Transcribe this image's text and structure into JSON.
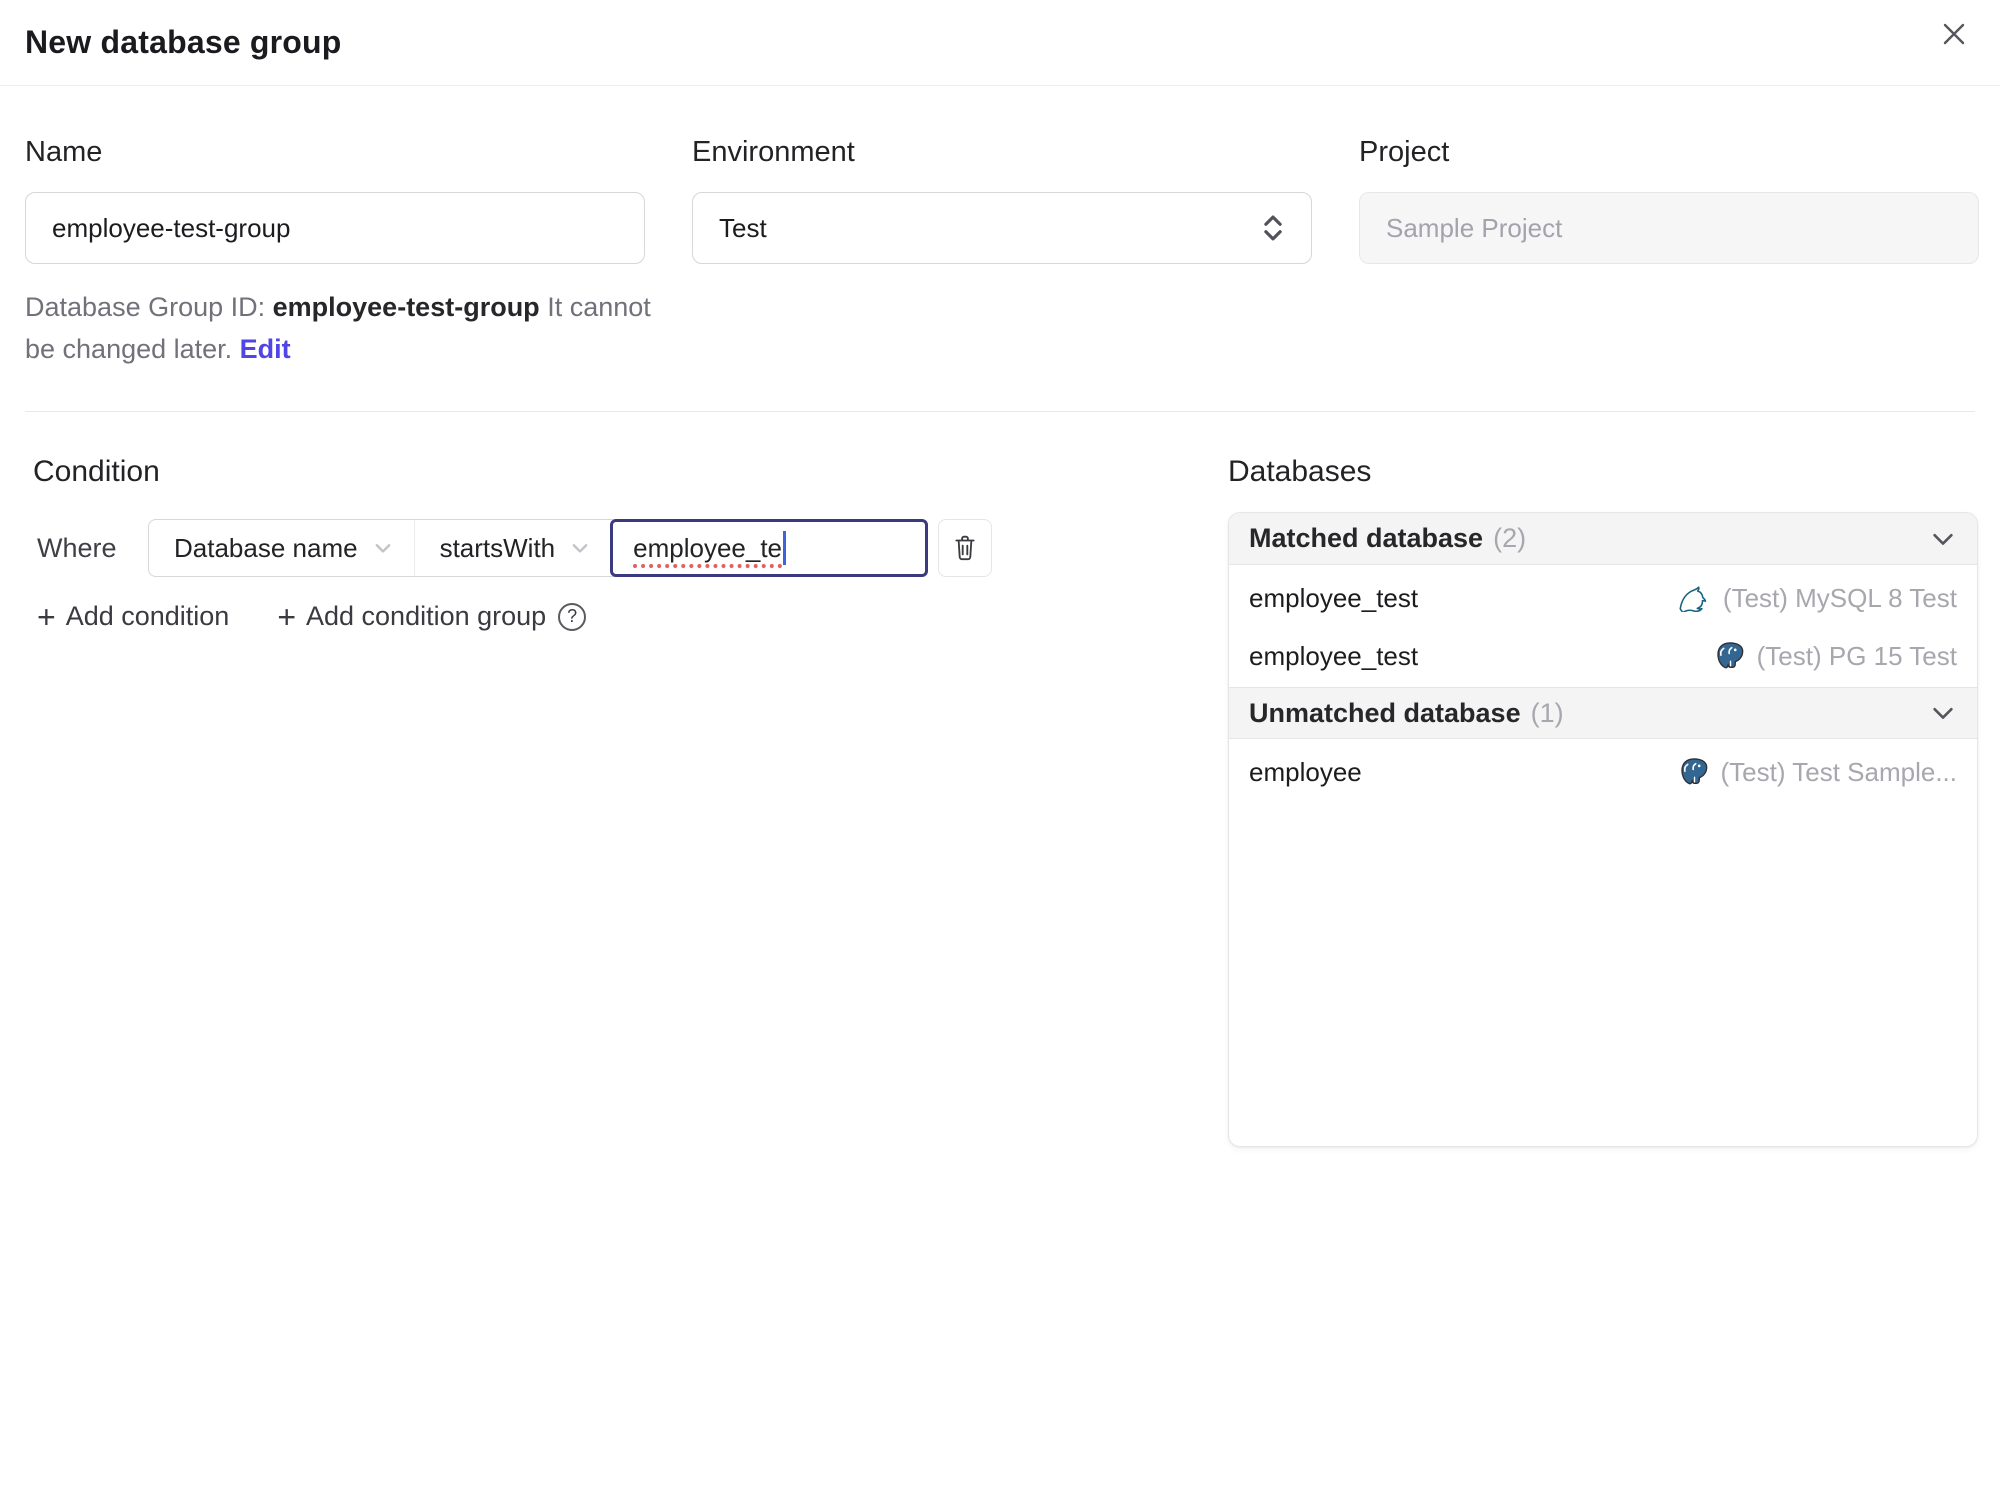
{
  "dialog": {
    "title": "New database group"
  },
  "form": {
    "name": {
      "label": "Name",
      "value": "employee-test-group"
    },
    "environment": {
      "label": "Environment",
      "value": "Test"
    },
    "project": {
      "label": "Project",
      "value": "Sample Project"
    },
    "id_hint": {
      "prefix": "Database Group ID: ",
      "id": "employee-test-group",
      "suffix": " It cannot be changed later. ",
      "edit_label": "Edit"
    }
  },
  "condition": {
    "heading": "Condition",
    "where_label": "Where",
    "factor": "Database name",
    "operator": "startsWith",
    "value": "employee_te",
    "add_condition_label": "Add condition",
    "add_condition_group_label": "Add condition group"
  },
  "databases": {
    "heading": "Databases",
    "matched": {
      "label": "Matched database",
      "count_display": "(2)",
      "rows": [
        {
          "name": "employee_test",
          "engine": "mysql",
          "instance": "(Test) MySQL 8 Test"
        },
        {
          "name": "employee_test",
          "engine": "postgres",
          "instance": "(Test) PG 15 Test"
        }
      ]
    },
    "unmatched": {
      "label": "Unmatched database",
      "count_display": "(1)",
      "rows": [
        {
          "name": "employee",
          "engine": "postgres",
          "instance": "(Test) Test Sample..."
        }
      ]
    }
  },
  "icons": {
    "plus": "+",
    "help": "?"
  },
  "colors": {
    "accent": "#4f46e5",
    "focus_border": "#3b3a80",
    "muted_text": "#a7a7ae",
    "mysql_brand": "#19647e",
    "postgres_brand": "#336791"
  }
}
